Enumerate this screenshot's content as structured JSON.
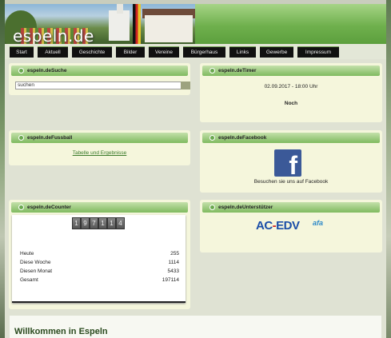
{
  "header": {
    "logo_text": "espeln.de"
  },
  "nav": {
    "items": [
      "Start",
      "Aktuell",
      "Geschichte",
      "Bilder",
      "Vereine",
      "Bürgerhaus",
      "Links",
      "Gewerbe",
      "Impressum"
    ]
  },
  "search": {
    "title": "espeln.deSuche",
    "value": "suchen"
  },
  "timer": {
    "title": "espeln.deTimer",
    "datetime": "02.09.2017 - 18:00 Uhr",
    "label": "Noch"
  },
  "fussball": {
    "title": "espeln.deFussball",
    "link": "Tabelle und Ergebnisse"
  },
  "facebook": {
    "title": "espeln.deFacebook",
    "icon": "facebook-icon",
    "glyph": "f",
    "caption": "Besuchen sie uns auf Facebook"
  },
  "counter": {
    "title": "espeln.deCounter",
    "digits": [
      "1",
      "9",
      "7",
      "1",
      "1",
      "4"
    ],
    "stats": [
      {
        "label": "Heute",
        "value": "255"
      },
      {
        "label": "Diese Woche",
        "value": "1114"
      },
      {
        "label": "Diesen Monat",
        "value": "5433"
      },
      {
        "label": "Gesamt",
        "value": "197114"
      }
    ]
  },
  "sponsor": {
    "title": "espeln.deUnterstützer",
    "logo_ac": "AC",
    "logo_dash": "-",
    "logo_edv": "EDV",
    "logo_afa": "afa"
  },
  "welcome": {
    "title": "Willkommen in Espeln"
  }
}
